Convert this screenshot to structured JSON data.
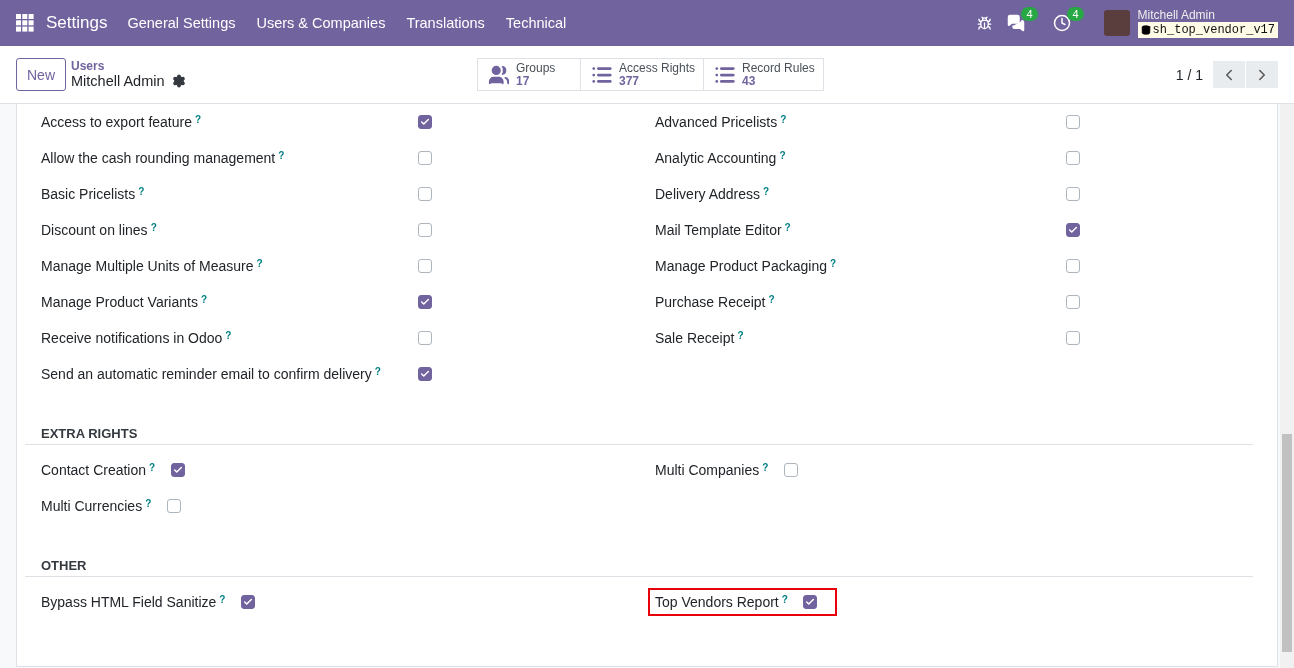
{
  "navbar": {
    "app": "Settings",
    "menu": [
      "General Settings",
      "Users & Companies",
      "Translations",
      "Technical"
    ],
    "messages_badge": "4",
    "activities_badge": "4",
    "user": "Mitchell Admin",
    "database": "sh_top_vendor_v17"
  },
  "control_panel": {
    "new_button": "New",
    "breadcrumb": "Users",
    "record": "Mitchell Admin",
    "stat_buttons": [
      {
        "kind": "users",
        "label": "Groups",
        "value": "17"
      },
      {
        "kind": "list",
        "label": "Access Rights",
        "value": "377"
      },
      {
        "kind": "bullets",
        "label": "Record Rules",
        "value": "43"
      }
    ],
    "pager": "1 / 1"
  },
  "sections": [
    {
      "kind": "aligned",
      "columns": [
        [
          {
            "label": "Access to export feature",
            "help": "?",
            "checked": true,
            "highlighted": false
          },
          {
            "label": "Allow the cash rounding management",
            "help": "?",
            "checked": false,
            "highlighted": false
          },
          {
            "label": "Basic Pricelists",
            "help": "?",
            "checked": false,
            "highlighted": false
          },
          {
            "label": "Discount on lines",
            "help": "?",
            "checked": false,
            "highlighted": false
          },
          {
            "label": "Manage Multiple Units of Measure",
            "help": "?",
            "checked": false,
            "highlighted": false
          },
          {
            "label": "Manage Product Variants",
            "help": "?",
            "checked": true,
            "highlighted": false
          },
          {
            "label": "Receive notifications in Odoo",
            "help": "?",
            "checked": false,
            "highlighted": false
          },
          {
            "label": "Send an automatic reminder email to confirm delivery",
            "help": "?",
            "checked": true,
            "highlighted": false
          }
        ],
        [
          {
            "label": "Advanced Pricelists",
            "help": "?",
            "checked": false,
            "highlighted": false
          },
          {
            "label": "Analytic Accounting",
            "help": "?",
            "checked": false,
            "highlighted": false
          },
          {
            "label": "Delivery Address",
            "help": "?",
            "checked": false,
            "highlighted": false
          },
          {
            "label": "Mail Template Editor",
            "help": "?",
            "checked": true,
            "highlighted": false
          },
          {
            "label": "Manage Product Packaging",
            "help": "?",
            "checked": false,
            "highlighted": false
          },
          {
            "label": "Purchase Receipt",
            "help": "?",
            "checked": false,
            "highlighted": false
          },
          {
            "label": "Sale Receipt",
            "help": "?",
            "checked": false,
            "highlighted": false
          }
        ]
      ]
    },
    {
      "kind": "inline",
      "title": "EXTRA RIGHTS",
      "columns": [
        [
          {
            "label": "Contact Creation",
            "help": "?",
            "checked": true,
            "highlighted": false
          },
          {
            "label": "Multi Currencies",
            "help": "?",
            "checked": false,
            "highlighted": false
          }
        ],
        [
          {
            "label": "Multi Companies",
            "help": "?",
            "checked": false,
            "highlighted": false
          }
        ]
      ]
    },
    {
      "kind": "inline",
      "title": "OTHER",
      "columns": [
        [
          {
            "label": "Bypass HTML Field Sanitize",
            "help": "?",
            "checked": true,
            "highlighted": false
          }
        ],
        [
          {
            "label": "Top Vendors Report",
            "help": "?",
            "checked": true,
            "highlighted": true
          }
        ]
      ]
    }
  ]
}
